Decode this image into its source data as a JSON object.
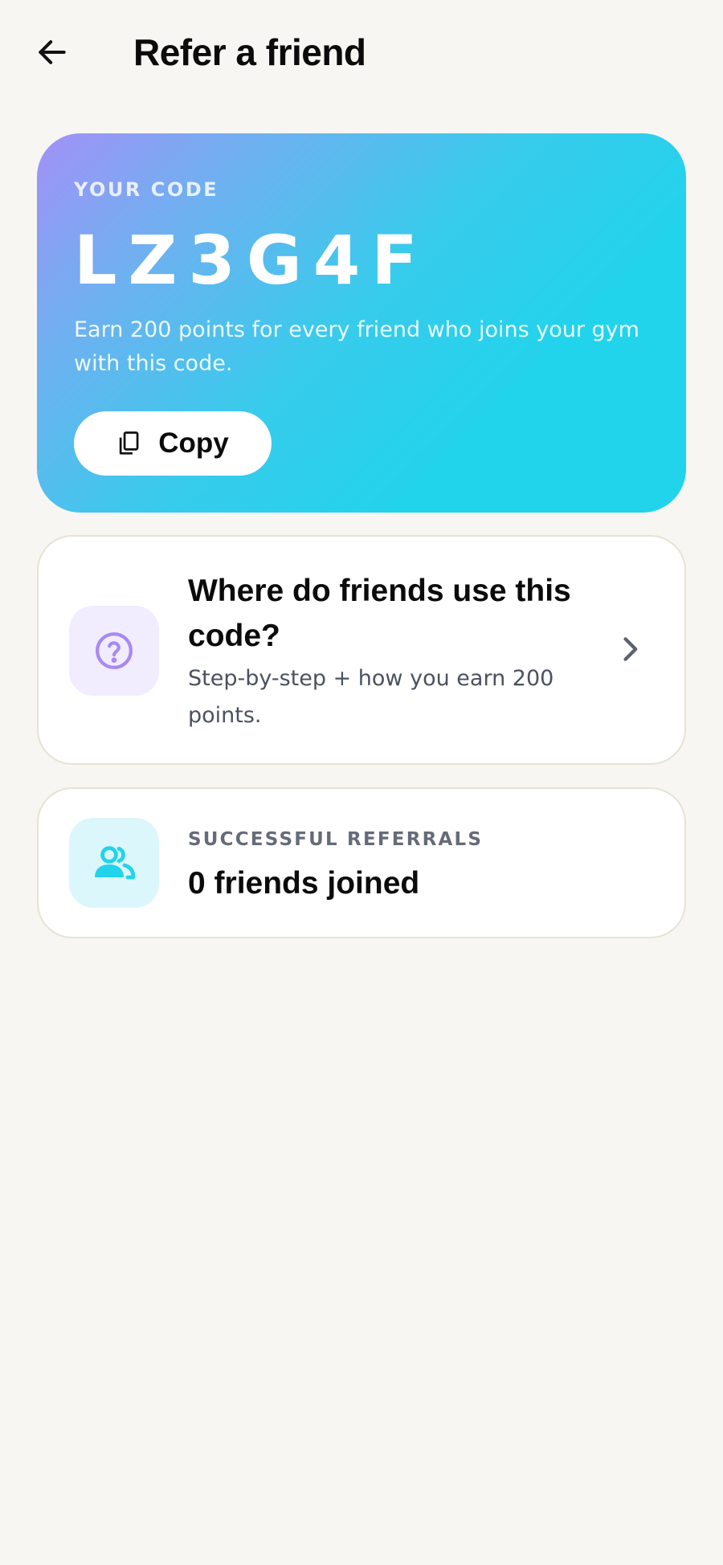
{
  "header": {
    "title": "Refer a friend",
    "back_icon": "arrow-left-icon"
  },
  "code_card": {
    "label": "YOUR CODE",
    "code": "LZ3G4F",
    "description": "Earn 200 points for every friend who joins your gym with this code.",
    "copy_label": "Copy",
    "copy_icon": "copy-icon",
    "gradient_start": "#a391f7",
    "gradient_end": "#22d3ec"
  },
  "help_card": {
    "title": "Where do friends use this code?",
    "subtitle": "Step-by-step + how you earn 200 points.",
    "icon": "question-circle-icon",
    "icon_color": "#a889f2",
    "chevron_icon": "chevron-right-icon"
  },
  "referrals_card": {
    "label": "SUCCESSFUL REFERRALS",
    "value": "0 friends joined",
    "icon": "users-icon",
    "icon_color": "#22d3ec"
  }
}
